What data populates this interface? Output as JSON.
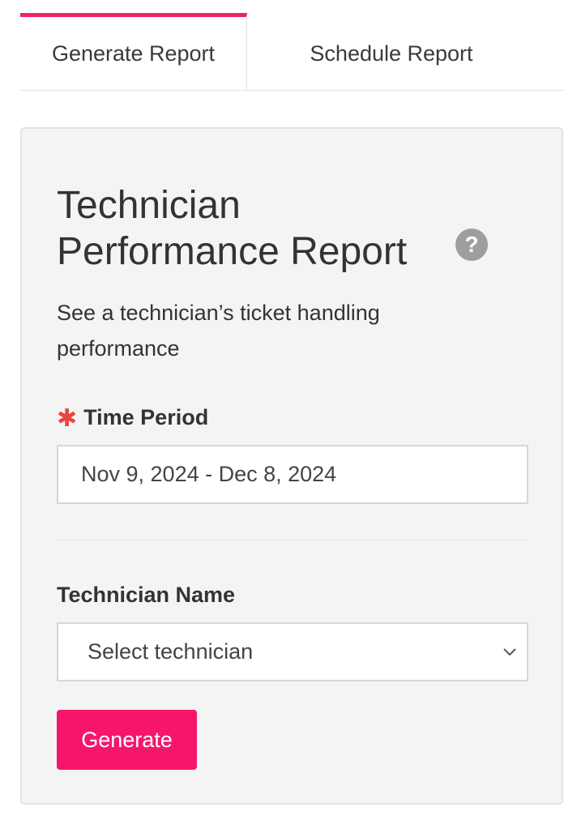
{
  "tabs": [
    {
      "label": "Generate Report",
      "active": true
    },
    {
      "label": "Schedule Report",
      "active": false
    }
  ],
  "report": {
    "title": "Technician Performance Report",
    "help_icon": "question-circle-icon",
    "help_glyph": "?",
    "subtitle": "See a technician’s ticket handling performance"
  },
  "time_period": {
    "required_mark": "✱",
    "label": "Time Period",
    "value": "Nov 9, 2024 - Dec 8, 2024"
  },
  "technician": {
    "label": "Technician Name",
    "placeholder": "Select technician",
    "chevron_icon": "chevron-down-icon"
  },
  "generate_button": {
    "label": "Generate"
  },
  "colors": {
    "accent": "#f0206f",
    "button": "#f5166c",
    "required": "#e8473f",
    "card_background": "#f4f4f4",
    "help_icon": "#9e9e9e"
  }
}
